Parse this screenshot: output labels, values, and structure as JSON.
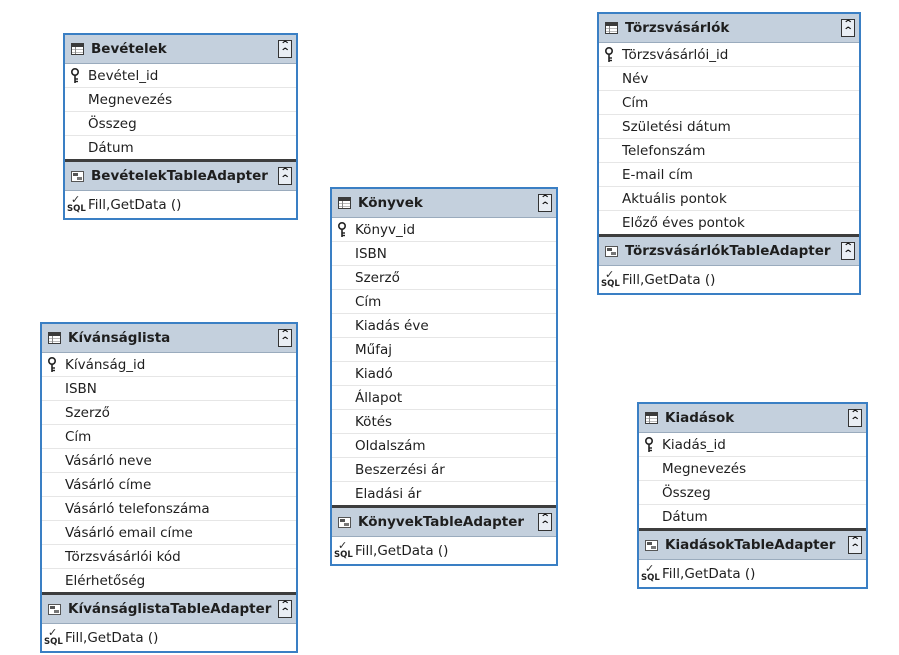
{
  "tables": [
    {
      "id": "bevetelek",
      "title": "Bevételek",
      "fields": [
        "Bevétel_id",
        "Megnevezés",
        "Összeg",
        "Dátum"
      ],
      "adapter": "BevételekTableAdapter",
      "method": "Fill,GetData ()"
    },
    {
      "id": "torzsvasarlok",
      "title": "Törzsvásárlók",
      "fields": [
        "Törzsvásárlói_id",
        "Név",
        "Cím",
        "Születési dátum",
        "Telefonszám",
        "E-mail cím",
        "Aktuális pontok",
        "Előző éves pontok"
      ],
      "adapter": "TörzsvásárlókTableAdapter",
      "method": "Fill,GetData ()"
    },
    {
      "id": "konyvek",
      "title": "Könyvek",
      "fields": [
        "Könyv_id",
        "ISBN",
        "Szerző",
        "Cím",
        "Kiadás éve",
        "Műfaj",
        "Kiadó",
        "Állapot",
        "Kötés",
        "Oldalszám",
        "Beszerzési ár",
        "Eladási ár"
      ],
      "adapter": "KönyvekTableAdapter",
      "method": "Fill,GetData ()"
    },
    {
      "id": "kivansaglista",
      "title": "Kívánságlista",
      "fields": [
        "Kívánság_id",
        "ISBN",
        "Szerző",
        "Cím",
        "Vásárló neve",
        "Vásárló címe",
        "Vásárló telefonszáma",
        "Vásárló email címe",
        "Törzsvásárlói kód",
        "Elérhetőség"
      ],
      "adapter": "KívánságlistaTableAdapter",
      "method": "Fill,GetData ()"
    },
    {
      "id": "kiadasok",
      "title": "Kiadások",
      "fields": [
        "Kiadás_id",
        "Megnevezés",
        "Összeg",
        "Dátum"
      ],
      "adapter": "KiadásokTableAdapter",
      "method": "Fill,GetData ()"
    }
  ],
  "sql_label": "SQL",
  "colors": {
    "border": "#3a7fc4",
    "header_bg": "#c4d0dd",
    "row_divider": "#e6e6e6"
  }
}
